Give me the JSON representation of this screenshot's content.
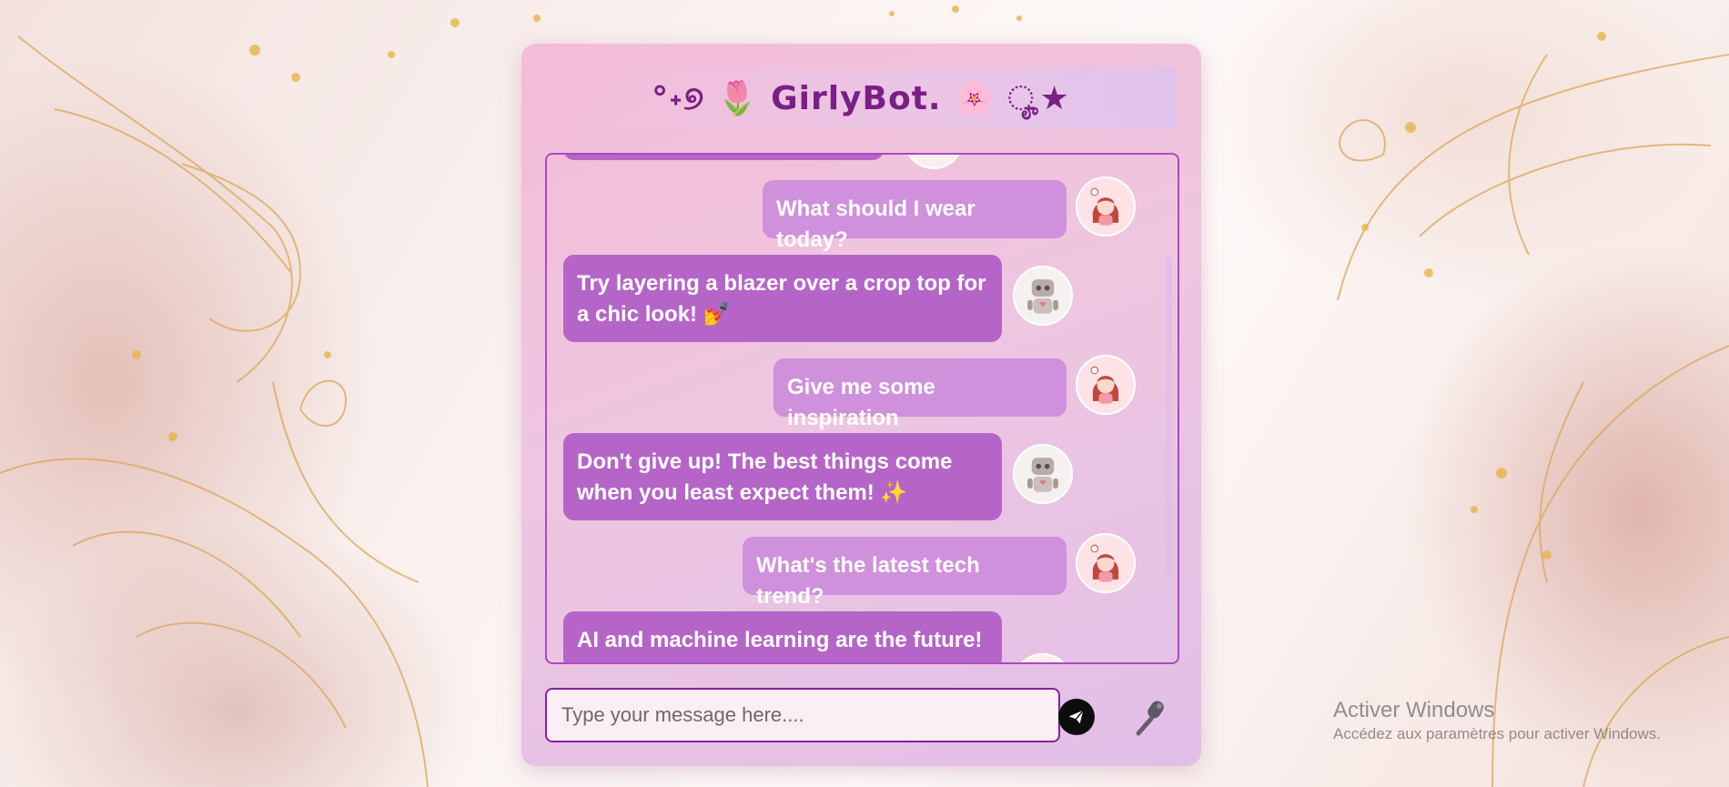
{
  "app": {
    "title": "°˖୭ 🌷 GirlyBot. 🌸 ೄ★"
  },
  "colors": {
    "accent": "#b048c0",
    "user_bubble": "#cf90dc",
    "bot_bubble": "#b565c8",
    "title": "#7a1f86"
  },
  "messages": [
    {
      "sender": "user",
      "text": "What should I wear today?",
      "avatar": "girl-avatar-icon"
    },
    {
      "sender": "bot",
      "text": "Try layering a blazer over a crop top for a chic look! 💅",
      "avatar": "robot-avatar-icon"
    },
    {
      "sender": "user",
      "text": "Give me some inspiration",
      "avatar": "girl-avatar-icon"
    },
    {
      "sender": "bot",
      "text": "Don't give up! The best things come when you least expect them! ✨",
      "avatar": "robot-avatar-icon"
    },
    {
      "sender": "user",
      "text": "What's the latest tech trend?",
      "avatar": "girl-avatar-icon"
    },
    {
      "sender": "bot",
      "text": "AI and machine learning are the future!",
      "avatar": "robot-avatar-icon"
    }
  ],
  "input": {
    "placeholder": "Type your message here....",
    "value": ""
  },
  "buttons": {
    "send_icon": "send-icon",
    "mic_icon": "microphone-icon"
  },
  "watermark": {
    "title": "Activer Windows",
    "subtitle": "Accédez aux paramètres pour activer Windows."
  }
}
